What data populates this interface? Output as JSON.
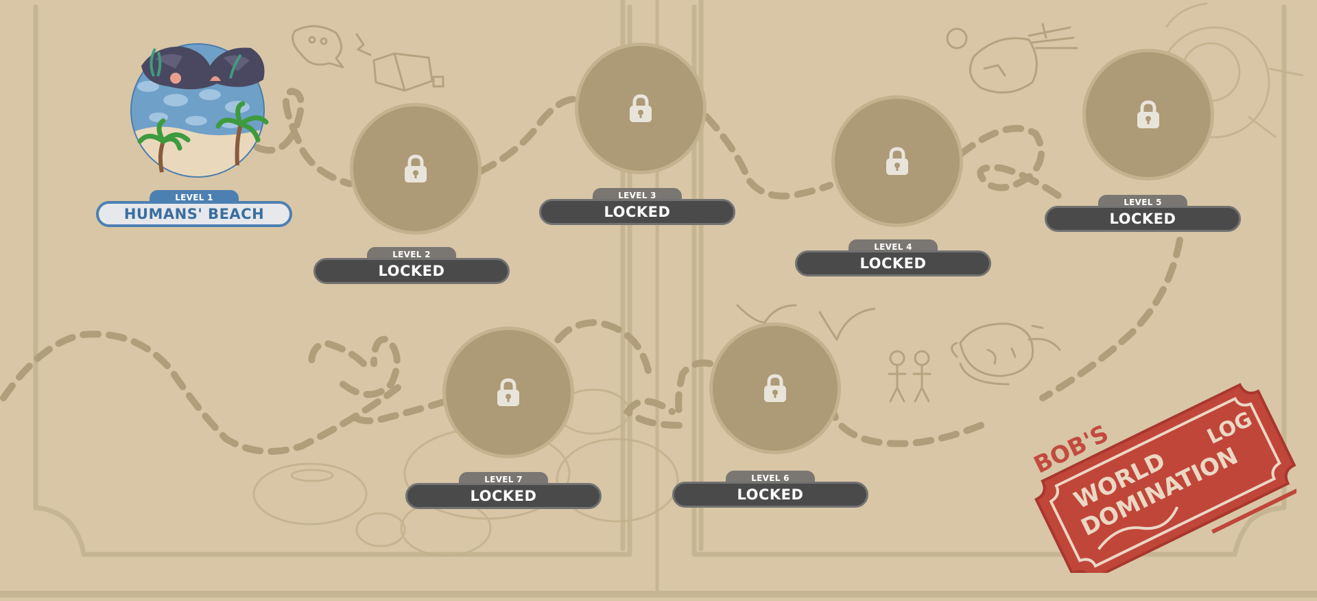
{
  "levels": [
    {
      "number_label": "LEVEL 1",
      "name": "HUMANS' BEACH",
      "status": "unlocked"
    },
    {
      "number_label": "LEVEL 2",
      "name": "LOCKED",
      "status": "locked"
    },
    {
      "number_label": "LEVEL 3",
      "name": "LOCKED",
      "status": "locked"
    },
    {
      "number_label": "LEVEL 4",
      "name": "LOCKED",
      "status": "locked"
    },
    {
      "number_label": "LEVEL 5",
      "name": "LOCKED",
      "status": "locked"
    },
    {
      "number_label": "LEVEL 6",
      "name": "LOCKED",
      "status": "locked"
    },
    {
      "number_label": "LEVEL 7",
      "name": "LOCKED",
      "status": "locked"
    }
  ],
  "stamp": {
    "owner": "BOB'S",
    "line1": "WORLD",
    "line2": "DOMINATION",
    "line3": "LOG"
  },
  "colors": {
    "background": "#d8c6a6",
    "doodle": "#c2b08c",
    "path": "#b1a07c",
    "node_fill": "#ad9a76",
    "locked_plate": "#4a4a4a",
    "unlocked_plate_border": "#4d80b2",
    "stamp_red": "#c0463a"
  },
  "icons": {
    "locked_node": "lock-icon",
    "stamp": "ticket-stamp-icon"
  }
}
